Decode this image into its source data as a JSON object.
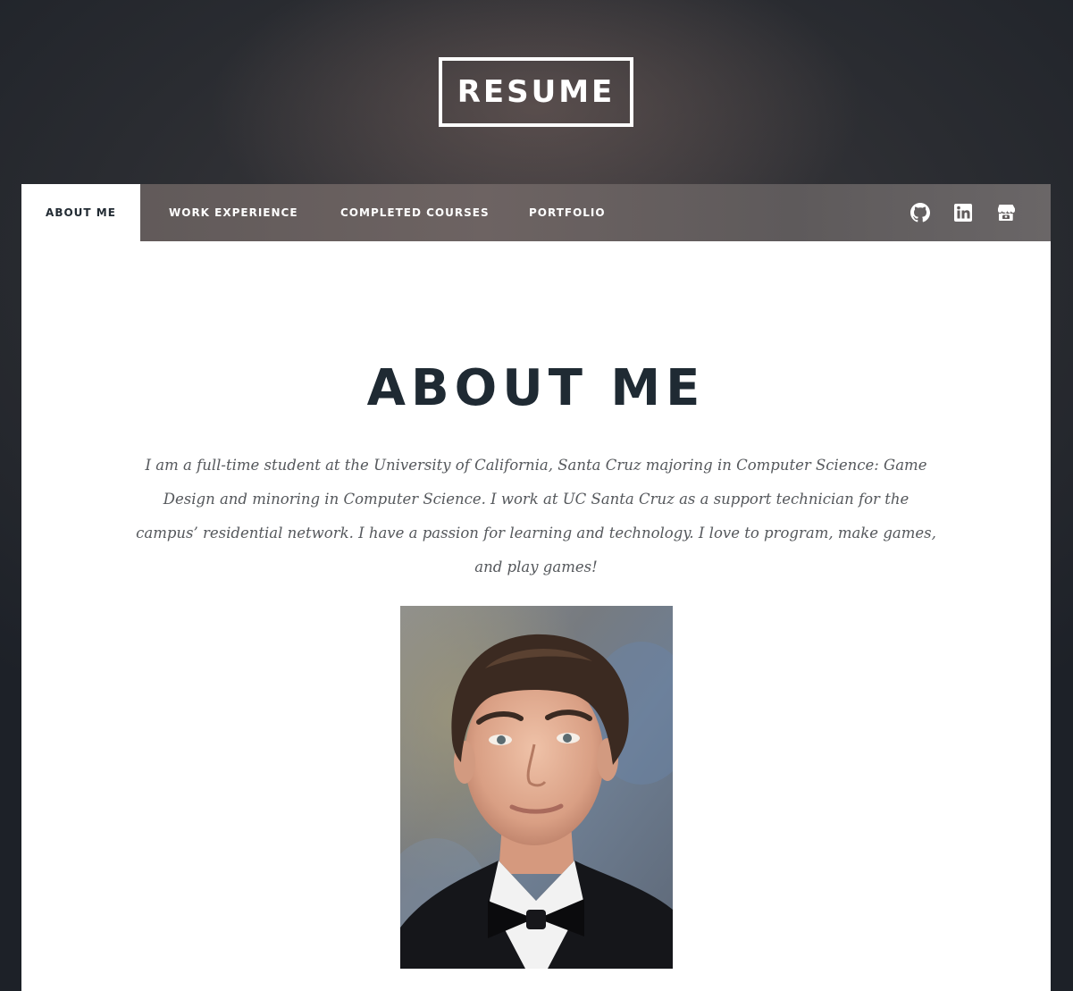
{
  "header": {
    "logo_text": "RESUME"
  },
  "nav": {
    "tabs": [
      {
        "label": "ABOUT ME",
        "active": true
      },
      {
        "label": "WORK EXPERIENCE",
        "active": false
      },
      {
        "label": "COMPLETED COURSES",
        "active": false
      },
      {
        "label": "PORTFOLIO",
        "active": false
      }
    ],
    "icons": [
      "github-icon",
      "linkedin-icon",
      "itch-io-icon"
    ]
  },
  "main": {
    "title": "ABOUT ME",
    "intro": "I am a full-time student at the University of California, Santa Cruz majoring in Computer Science: Game Design and minoring in Computer Science. I work at UC Santa Cruz as a support technician for the campus’ residential network. I have a passion for learning and technology. I love to program, make games, and play games!"
  },
  "colors": {
    "nav_bar": "#615b5b",
    "title": "#1f2a33",
    "body_text": "#55585c",
    "content_bg": "#ffffff"
  }
}
